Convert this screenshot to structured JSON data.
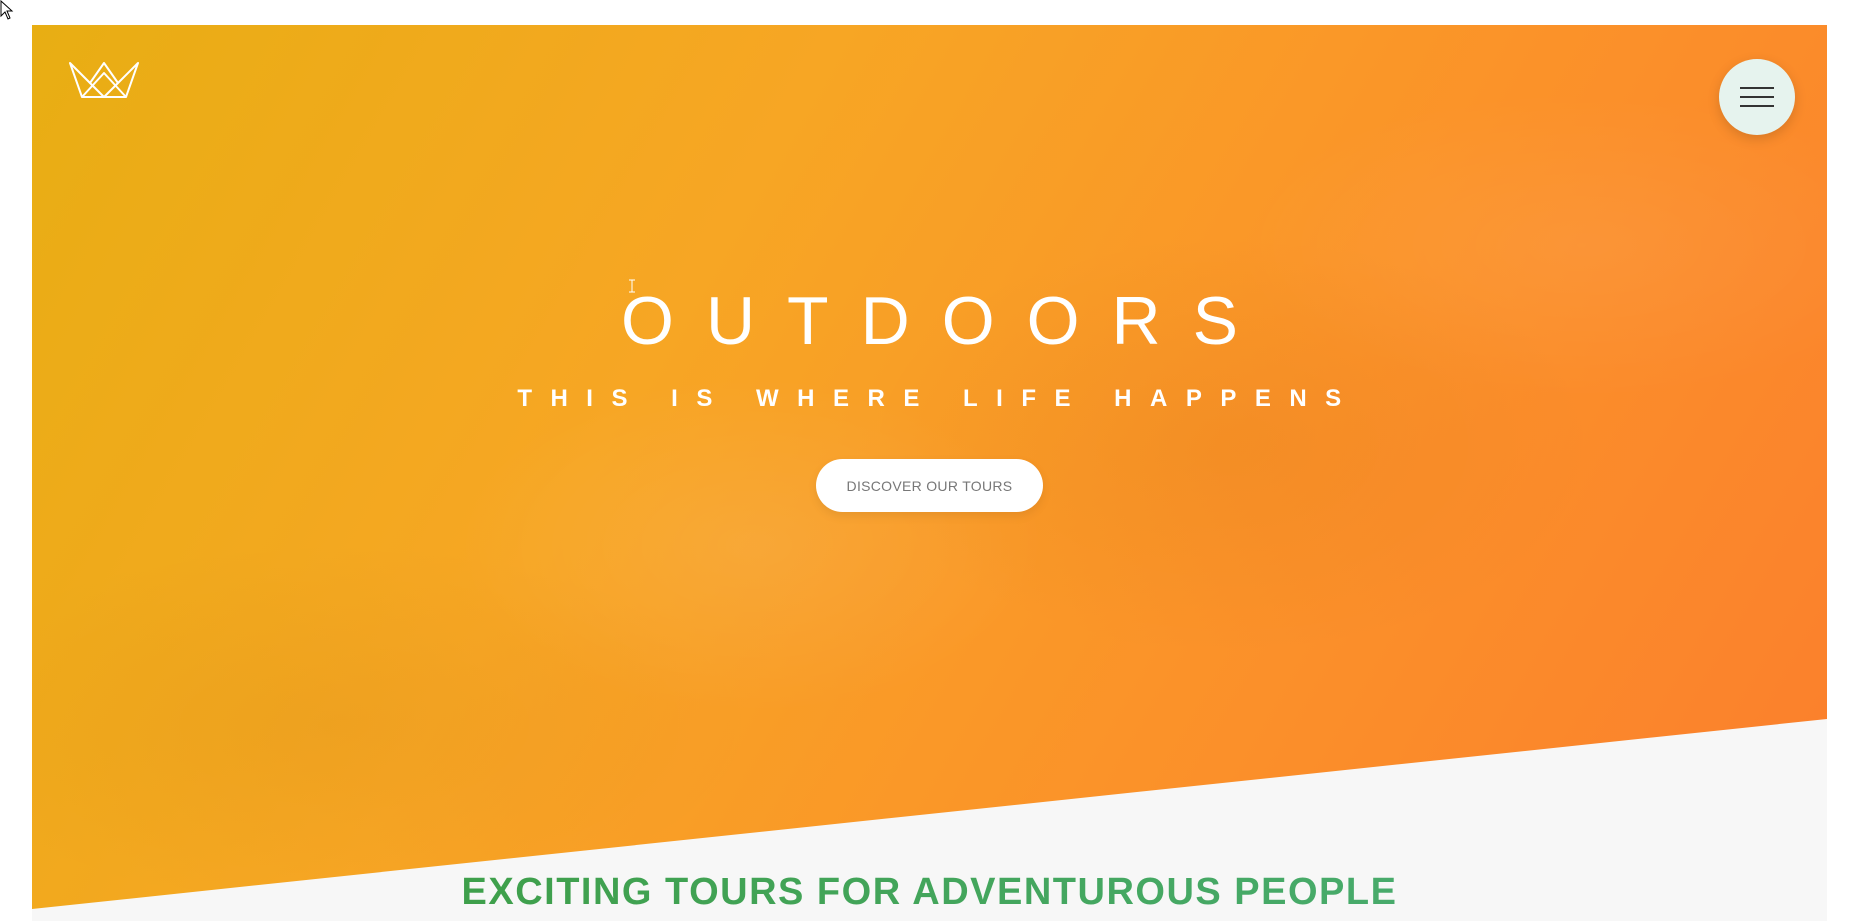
{
  "hero": {
    "title": "OUTDOORS",
    "subtitle": "THIS IS WHERE LIFE HAPPENS",
    "cta_label": "DISCOVER OUR TOURS",
    "gradient_colors": [
      "#e8ae13",
      "#f7a624",
      "#fb9329",
      "#fb7e2d"
    ]
  },
  "header": {
    "logo_icon": "crown-icon",
    "menu_icon": "hamburger-menu-icon",
    "menu_button_color": "#e6f3ee"
  },
  "section": {
    "heading": "EXCITING TOURS FOR ADVENTUROUS PEOPLE",
    "heading_colors": [
      "#3a9a3c",
      "#4cb07a"
    ]
  }
}
